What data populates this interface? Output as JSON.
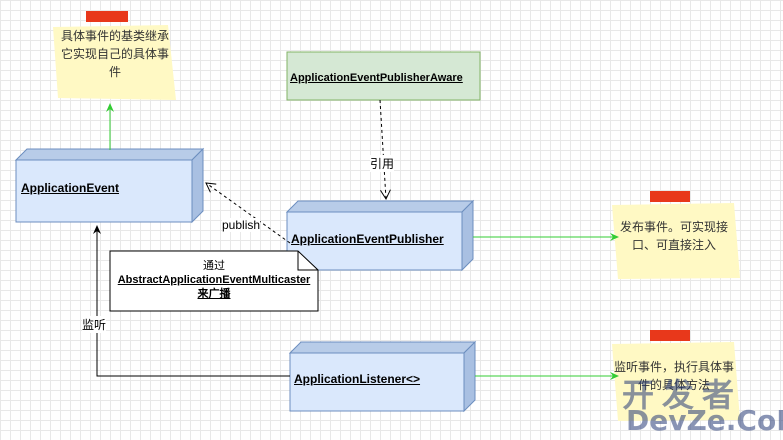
{
  "nodes": {
    "application_event": "ApplicationEvent",
    "publisher_aware": "ApplicationEventPublisherAware",
    "publisher": "ApplicationEventPublisher",
    "listener": "ApplicationListener<>"
  },
  "notes": {
    "base_class": "具体事件的基类继承它实现自己的具体事件",
    "publish_event": "发布事件。可实现接口、可直接注入",
    "listen_event": "监听事件，执行具体事件的具体方法"
  },
  "edge_labels": {
    "reference": "引用",
    "publish": "publish",
    "listen": "监听"
  },
  "callout": {
    "line1": "通过",
    "line2": "AbstractApplicationEventMulticaster",
    "line3": "来广播"
  },
  "watermark": {
    "top": "开发者",
    "bottom": "DevZe.CoM"
  },
  "colors": {
    "node_fill": "#dae8fc",
    "node_stroke": "#6c8ebf",
    "aware_fill": "#d5e8d4",
    "aware_stroke": "#82b366",
    "note_fill": "#fff9c4",
    "tape_red": "#e8381b",
    "green_arrow": "#33cc33"
  }
}
